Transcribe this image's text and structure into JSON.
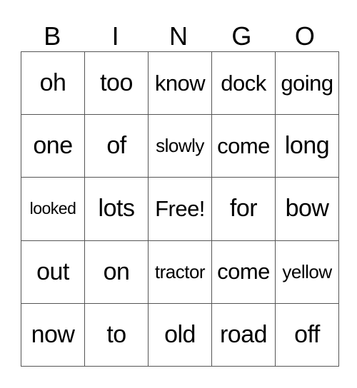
{
  "header": [
    "B",
    "I",
    "N",
    "G",
    "O"
  ],
  "rows": [
    [
      "oh",
      "too",
      "know",
      "dock",
      "going"
    ],
    [
      "one",
      "of",
      "slowly",
      "come",
      "long"
    ],
    [
      "looked",
      "lots",
      "Free!",
      "for",
      "bow"
    ],
    [
      "out",
      "on",
      "tractor",
      "come",
      "yellow"
    ],
    [
      "now",
      "to",
      "old",
      "road",
      "off"
    ]
  ]
}
